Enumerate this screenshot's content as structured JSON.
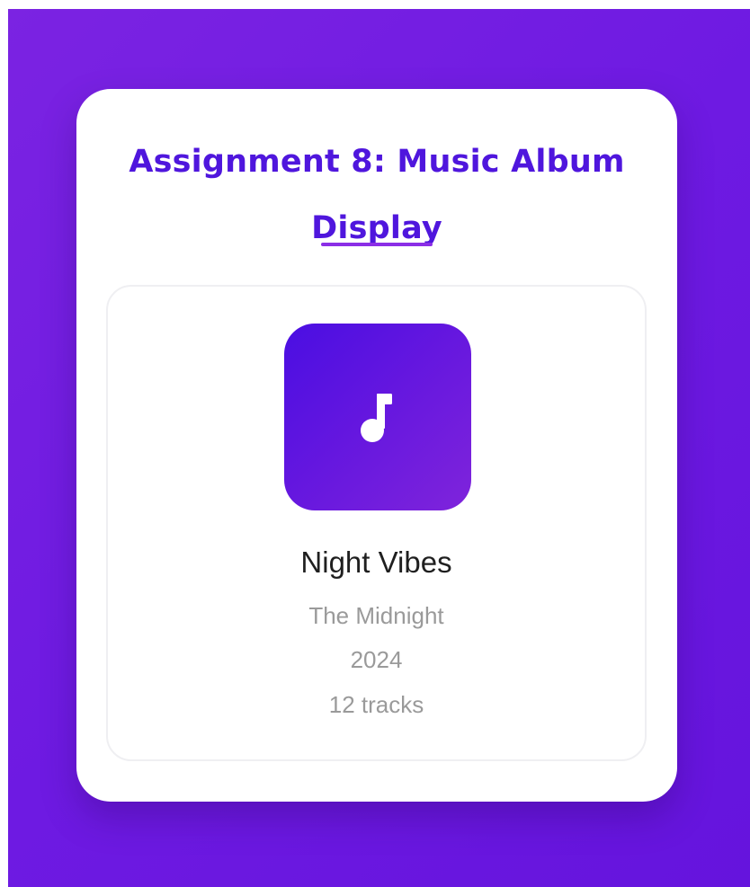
{
  "page": {
    "title_line_1": "Assignment 8: Music Album",
    "title_line_2": "Display"
  },
  "album": {
    "title": "Night Vibes",
    "artist": "The Midnight",
    "year": "2024",
    "tracks": "12 tracks",
    "icon": "music-note-icon"
  },
  "colors": {
    "background": "#6f1be2",
    "card": "#ffffff",
    "heading": "#4f16dd",
    "accent": "#8b2ee6",
    "album_art_start": "#4a0ee2",
    "album_art_end": "#7f24db",
    "muted_text": "#9a9a9a"
  }
}
